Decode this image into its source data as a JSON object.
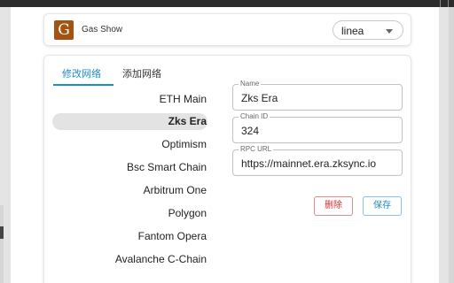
{
  "app": {
    "title": "Gas Show",
    "logo_letter": "G",
    "logo_color": "#a35410"
  },
  "chain_select": {
    "value": "linea"
  },
  "tabs": [
    {
      "label": "修改网络",
      "active": true
    },
    {
      "label": "添加网络",
      "active": false
    }
  ],
  "chains": [
    {
      "label": "ETH Main",
      "selected": false
    },
    {
      "label": "Zks Era",
      "selected": true
    },
    {
      "label": "Optimism",
      "selected": false
    },
    {
      "label": "Bsc Smart Chain",
      "selected": false
    },
    {
      "label": "Arbitrum One",
      "selected": false
    },
    {
      "label": "Polygon",
      "selected": false
    },
    {
      "label": "Fantom Opera",
      "selected": false
    },
    {
      "label": "Avalanche C-Chain",
      "selected": false
    }
  ],
  "form": {
    "name": {
      "label": "Name",
      "value": "Zks Era"
    },
    "chain_id": {
      "label": "Chain ID",
      "value": "324"
    },
    "rpc_url": {
      "label": "RPC URL",
      "value": "https://mainnet.era.zksync.io"
    }
  },
  "buttons": {
    "delete_label": "删除",
    "save_label": "保存"
  },
  "colors": {
    "accent": "#1e8bd0",
    "danger": "#d03030"
  }
}
